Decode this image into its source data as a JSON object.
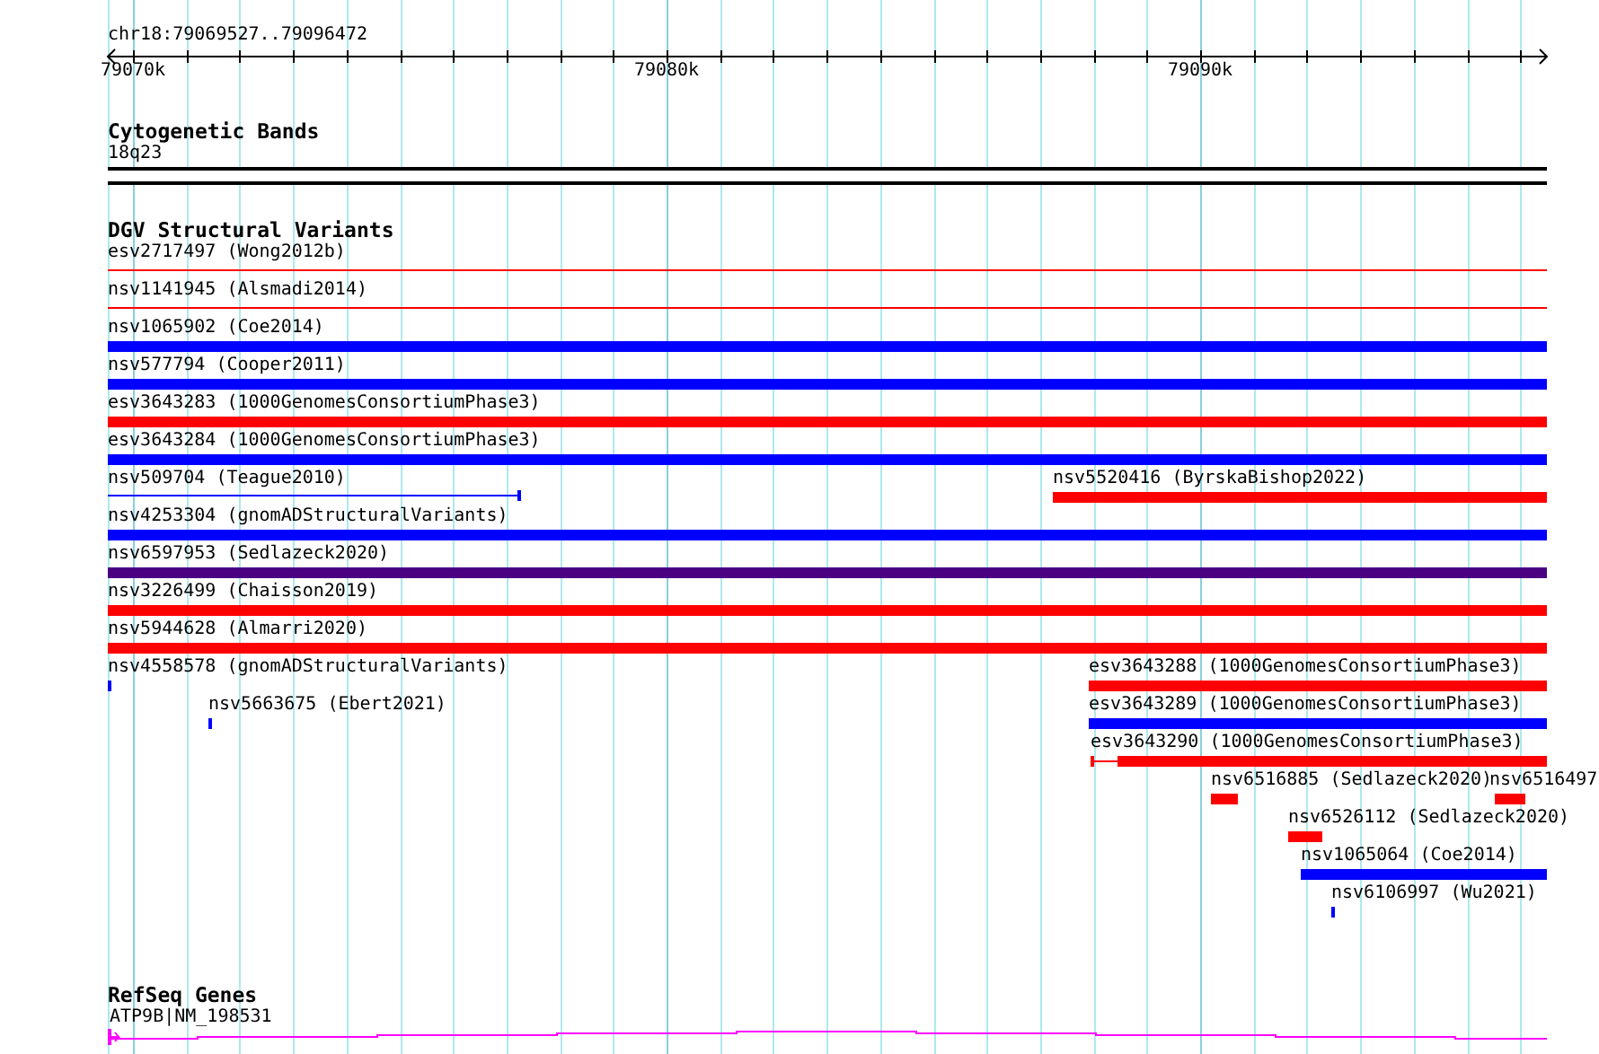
{
  "ruler": {
    "location": "chr18:79069527..79096472",
    "ticks": [
      "79070k",
      "79080k",
      "79090k"
    ]
  },
  "tracks": [
    {
      "kind": "bands",
      "title": "Cytogenetic Bands",
      "features": [
        {
          "label": "18q23",
          "kind": "band"
        }
      ]
    },
    {
      "kind": "variants",
      "title": "DGV Structural Variants",
      "features": [
        {
          "label": "esv2717497 (Wong2012b)",
          "kind": "line",
          "color": "#ff0000"
        },
        {
          "label": "nsv1141945 (Alsmadi2014)",
          "kind": "line",
          "color": "#ff0000"
        },
        {
          "label": "nsv1065902 (Coe2014)",
          "kind": "bar",
          "color": "#0000ff"
        },
        {
          "label": "nsv577794 (Cooper2011)",
          "kind": "bar",
          "color": "#0000ff"
        },
        {
          "label": "esv3643283 (1000GenomesConsortiumPhase3)",
          "kind": "bar",
          "color": "#ff0000"
        },
        {
          "label": "esv3643284 (1000GenomesConsortiumPhase3)",
          "kind": "bar",
          "color": "#0000ff"
        },
        {
          "label": "nsv509704 (Teague2010)",
          "kind": "line",
          "color": "#0000ff"
        },
        {
          "label": "nsv5520416 (ByrskaBishop2022)",
          "kind": "bar",
          "color": "#ff0000"
        },
        {
          "label": "nsv4253304 (gnomADStructuralVariants)",
          "kind": "bar",
          "color": "#0000ff"
        },
        {
          "label": "nsv6597953 (Sedlazeck2020)",
          "kind": "bar",
          "color": "#4b0082"
        },
        {
          "label": "nsv3226499 (Chaisson2019)",
          "kind": "bar",
          "color": "#ff0000"
        },
        {
          "label": "nsv5944628 (Almarri2020)",
          "kind": "bar",
          "color": "#ff0000"
        },
        {
          "label": "nsv4558578 (gnomADStructuralVariants)",
          "kind": "bar",
          "color": "#0000ff"
        },
        {
          "label": "esv3643288 (1000GenomesConsortiumPhase3)",
          "kind": "bar",
          "color": "#ff0000"
        },
        {
          "label": "nsv5663675 (Ebert2021)",
          "kind": "bar",
          "color": "#0000ff"
        },
        {
          "label": "esv3643289 (1000GenomesConsortiumPhase3)",
          "kind": "bar",
          "color": "#0000ff"
        },
        {
          "label": "esv3643290 (1000GenomesConsortiumPhase3)",
          "kind": "gapped",
          "color": "#ff0000"
        },
        {
          "label": "nsv6516885 (Sedlazeck2020)",
          "kind": "bar",
          "color": "#ff0000"
        },
        {
          "label": "nsv6516497",
          "kind": "bar",
          "color": "#ff0000"
        },
        {
          "label": "nsv6526112 (Sedlazeck2020)",
          "kind": "bar",
          "color": "#ff0000"
        },
        {
          "label": "nsv1065064 (Coe2014)",
          "kind": "bar",
          "color": "#0000ff"
        },
        {
          "label": "nsv6106997 (Wu2021)",
          "kind": "bar",
          "color": "#0000ff"
        }
      ]
    },
    {
      "kind": "genes",
      "title": "RefSeq Genes",
      "features": [
        {
          "label": "ATP9B|NM_198531",
          "kind": "gene",
          "color": "#ff00ff"
        }
      ]
    }
  ]
}
